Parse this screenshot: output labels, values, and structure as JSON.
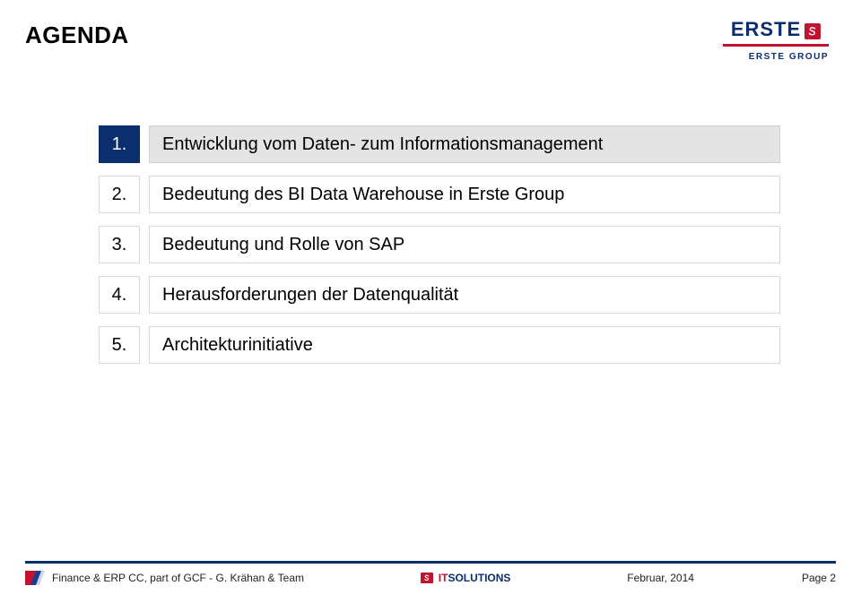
{
  "header": {
    "title": "AGENDA"
  },
  "logo": {
    "word": "ERSTE",
    "subtext": "ERSTE GROUP"
  },
  "agenda": {
    "items": [
      {
        "num": "1.",
        "text": "Entwicklung vom Daten- zum Informationsmanagement",
        "active": true
      },
      {
        "num": "2.",
        "text": "Bedeutung des BI Data Warehouse in Erste Group",
        "active": false
      },
      {
        "num": "3.",
        "text": "Bedeutung und Rolle von SAP",
        "active": false
      },
      {
        "num": "4.",
        "text": "Herausforderungen der Datenqualität",
        "active": false
      },
      {
        "num": "5.",
        "text": "Architekturinitiative",
        "active": false
      }
    ]
  },
  "footer": {
    "left": "Finance & ERP CC, part of GCF - G. Krähan & Team",
    "center_it": "IT",
    "center_sol": "SOLUTIONS",
    "date": "Februar, 2014",
    "page": "Page 2"
  }
}
